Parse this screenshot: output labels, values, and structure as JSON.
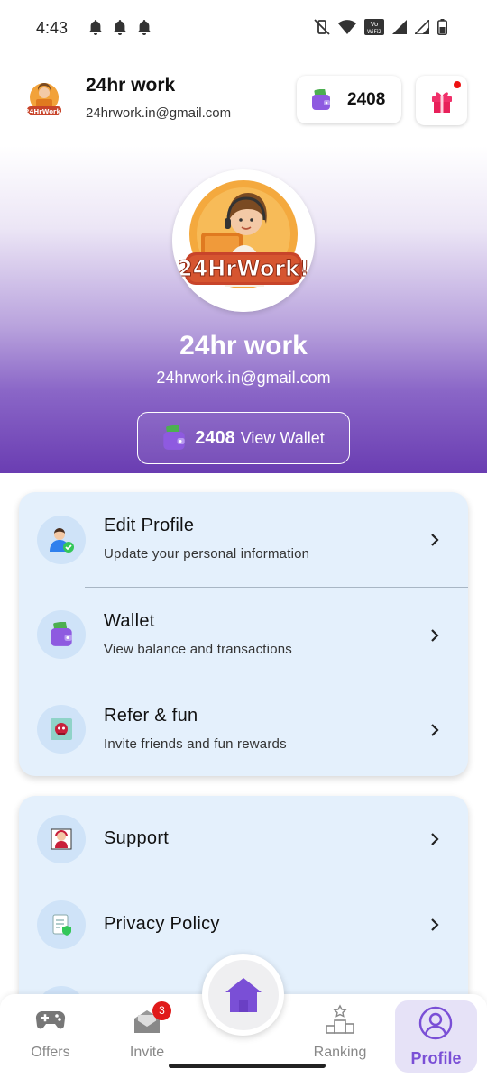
{
  "status_bar": {
    "time": "4:43",
    "network_label": "Vo WiFi2"
  },
  "header": {
    "name": "24hr work",
    "email": "24hrwork.in@gmail.com",
    "coins": "2408",
    "logo_text": "24HrWork!"
  },
  "hero": {
    "name": "24hr work",
    "email": "24hrwork.in@gmail.com",
    "wallet_amount": "2408",
    "wallet_label": "View Wallet",
    "logo_text": "24HrWork!"
  },
  "menu_primary": [
    {
      "title": "Edit Profile",
      "subtitle": "Update your personal information",
      "icon": "user-shield-icon"
    },
    {
      "title": "Wallet",
      "subtitle": "View balance and transactions",
      "icon": "wallet-icon"
    },
    {
      "title": "Refer & fun",
      "subtitle": "Invite friends and fun rewards",
      "icon": "gift-card-icon"
    }
  ],
  "menu_secondary": [
    {
      "title": "Support",
      "icon": "support-agent-icon"
    },
    {
      "title": "Privacy Policy",
      "icon": "document-shield-icon"
    }
  ],
  "bottom_nav": {
    "offers": "Offers",
    "invite": "Invite",
    "invite_badge": "3",
    "ranking": "Ranking",
    "profile": "Profile"
  },
  "colors": {
    "accent": "#7a4fd6",
    "hero_dark": "#6a3db2",
    "card_bg": "#e4f0fc",
    "badge": "#e01a1a"
  }
}
